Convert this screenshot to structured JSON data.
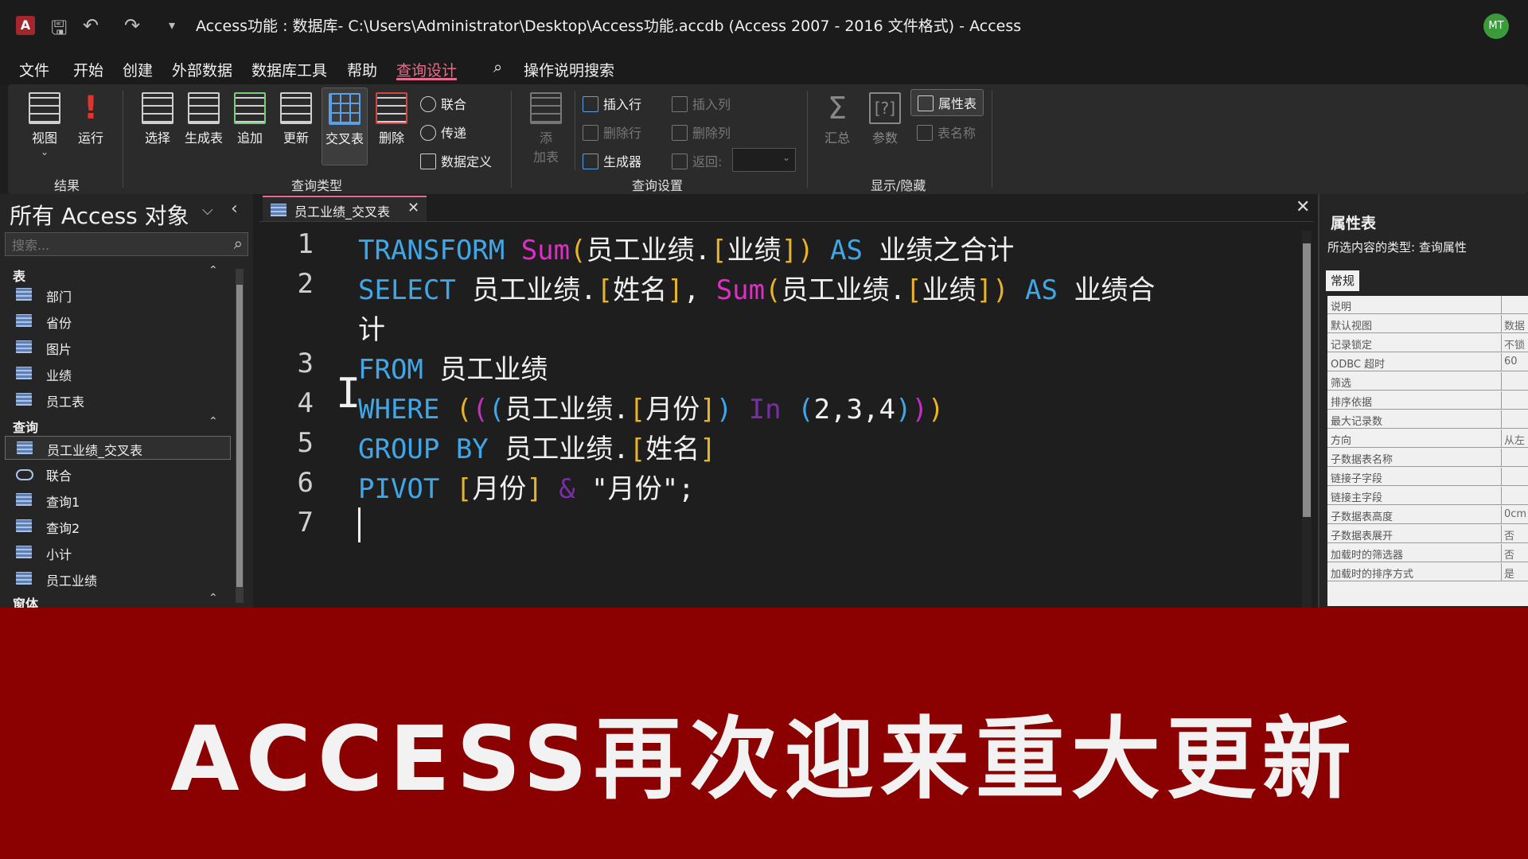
{
  "titlebar": {
    "app_icon": "A",
    "title": "Access功能 : 数据库- C:\\Users\\Administrator\\Desktop\\Access功能.accdb (Access 2007 - 2016 文件格式)  -  Access",
    "avatar": "MT",
    "icons": [
      "save-icon",
      "undo-icon",
      "redo-icon",
      "customize-icon"
    ]
  },
  "menu": {
    "items": [
      "文件",
      "开始",
      "创建",
      "外部数据",
      "数据库工具",
      "帮助",
      "查询设计"
    ],
    "active": "查询设计",
    "search_label": "操作说明搜索"
  },
  "ribbon": {
    "results": {
      "label": "结果",
      "view": "视图",
      "run": "运行"
    },
    "query_type": {
      "label": "查询类型",
      "select": "选择",
      "make_table": "生成表",
      "append": "追加",
      "update": "更新",
      "crosstab": "交叉表",
      "delete": "删除",
      "union": "联合",
      "pass_through": "传递",
      "data_definition": "数据定义"
    },
    "query_setup": {
      "label": "查询设置",
      "add_table_1": "添",
      "add_table_2": "加表",
      "insert_row": "插入行",
      "delete_row": "删除行",
      "builder": "生成器",
      "insert_col": "插入列",
      "delete_col": "删除列",
      "return_label": "返回:"
    },
    "show_hide": {
      "label": "显示/隐藏",
      "totals": "汇总",
      "parameters": "参数",
      "property_sheet": "属性表",
      "table_names": "表名称"
    }
  },
  "nav": {
    "header": "所有 Access 对象",
    "search_placeholder": "搜索...",
    "sections": [
      {
        "title": "表",
        "items": [
          "部门",
          "省份",
          "图片",
          "业绩",
          "员工表"
        ]
      },
      {
        "title": "查询",
        "items": [
          "员工业绩_交叉表",
          "联合",
          "查询1",
          "查询2",
          "小计",
          "员工业绩"
        ]
      },
      {
        "title": "窗体",
        "items": []
      }
    ],
    "selected": "员工业绩_交叉表"
  },
  "editor": {
    "tab_label": "员工业绩_交叉表",
    "lines": [
      {
        "n": "1",
        "parts": [
          [
            "kw",
            "TRANSFORM "
          ],
          [
            "fn",
            "Sum"
          ],
          [
            "br",
            "("
          ],
          [
            "nm",
            "员工业绩."
          ],
          [
            "br",
            "["
          ],
          [
            "nm",
            "业绩"
          ],
          [
            "br",
            "]"
          ],
          [
            "br",
            ")"
          ],
          [
            "kw",
            " AS "
          ],
          [
            "nm",
            "业绩之合计"
          ]
        ]
      },
      {
        "n": "2",
        "parts": [
          [
            "kw",
            "SELECT "
          ],
          [
            "nm",
            "员工业绩."
          ],
          [
            "br",
            "["
          ],
          [
            "nm",
            "姓名"
          ],
          [
            "br",
            "]"
          ],
          [
            "nm",
            ", "
          ],
          [
            "fn",
            "Sum"
          ],
          [
            "br",
            "("
          ],
          [
            "nm",
            "员工业绩."
          ],
          [
            "br",
            "["
          ],
          [
            "nm",
            "业绩"
          ],
          [
            "br",
            "]"
          ],
          [
            "br",
            ")"
          ],
          [
            "kw",
            " AS "
          ],
          [
            "nm",
            "业绩合"
          ]
        ]
      },
      {
        "n": "",
        "parts": [
          [
            "nm",
            "计"
          ]
        ]
      },
      {
        "n": "3",
        "parts": [
          [
            "kw",
            "FROM "
          ],
          [
            "nm",
            "员工业绩"
          ]
        ]
      },
      {
        "n": "4",
        "parts": [
          [
            "kw",
            "WHERE "
          ],
          [
            "br",
            "("
          ],
          [
            "pi",
            "("
          ],
          [
            "pb",
            "("
          ],
          [
            "nm",
            "员工业绩."
          ],
          [
            "br",
            "["
          ],
          [
            "nm",
            "月份"
          ],
          [
            "br",
            "]"
          ],
          [
            "pb",
            ")"
          ],
          [
            "op",
            " In "
          ],
          [
            "pb",
            "("
          ],
          [
            "nm",
            "2,3,4"
          ],
          [
            "pb",
            ")"
          ],
          [
            "pi",
            ")"
          ],
          [
            "br",
            ")"
          ]
        ]
      },
      {
        "n": "5",
        "parts": [
          [
            "kw",
            "GROUP BY "
          ],
          [
            "nm",
            "员工业绩."
          ],
          [
            "br",
            "["
          ],
          [
            "nm",
            "姓名"
          ],
          [
            "br",
            "]"
          ]
        ]
      },
      {
        "n": "6",
        "parts": [
          [
            "kw",
            "PIVOT "
          ],
          [
            "br",
            "["
          ],
          [
            "nm",
            "月份"
          ],
          [
            "br",
            "]"
          ],
          [
            "op",
            " & "
          ],
          [
            "str",
            "\"月份\";"
          ]
        ]
      },
      {
        "n": "7",
        "parts": []
      }
    ]
  },
  "property_sheet": {
    "title": "属性表",
    "selection_type": "所选内容的类型:  查询属性",
    "tab": "常规",
    "rows": [
      {
        "k": "说明",
        "v": ""
      },
      {
        "k": "默认视图",
        "v": "数据"
      },
      {
        "k": "记录锁定",
        "v": "不锁"
      },
      {
        "k": "ODBC 超时",
        "v": "60"
      },
      {
        "k": "筛选",
        "v": ""
      },
      {
        "k": "排序依据",
        "v": ""
      },
      {
        "k": "最大记录数",
        "v": ""
      },
      {
        "k": "方向",
        "v": "从左"
      },
      {
        "k": "子数据表名称",
        "v": ""
      },
      {
        "k": "链接子字段",
        "v": ""
      },
      {
        "k": "链接主字段",
        "v": ""
      },
      {
        "k": "子数据表高度",
        "v": "0cm"
      },
      {
        "k": "子数据表展开",
        "v": "否"
      },
      {
        "k": "加载时的筛选器",
        "v": "否"
      },
      {
        "k": "加载时的排序方式",
        "v": "是"
      }
    ]
  },
  "banner": {
    "text": "ACCESS再次迎来重大更新"
  }
}
